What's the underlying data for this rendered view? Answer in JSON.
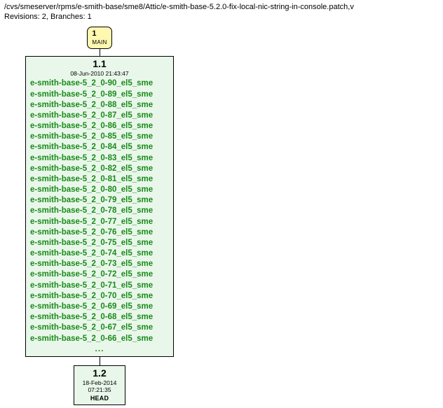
{
  "header": {
    "path": "/cvs/smeserver/rpms/e-smith-base/sme8/Attic/e-smith-base-5.2.0-fix-local-nic-string-in-console.patch,v",
    "revisions_label": "Revisions: 2, Branches: 1"
  },
  "branch": {
    "number": "1",
    "name": "MAIN"
  },
  "rev11": {
    "title": "1.1",
    "date": "08-Jun-2010 21:43:47",
    "tags": [
      "e-smith-base-5_2_0-90_el5_sme",
      "e-smith-base-5_2_0-89_el5_sme",
      "e-smith-base-5_2_0-88_el5_sme",
      "e-smith-base-5_2_0-87_el5_sme",
      "e-smith-base-5_2_0-86_el5_sme",
      "e-smith-base-5_2_0-85_el5_sme",
      "e-smith-base-5_2_0-84_el5_sme",
      "e-smith-base-5_2_0-83_el5_sme",
      "e-smith-base-5_2_0-82_el5_sme",
      "e-smith-base-5_2_0-81_el5_sme",
      "e-smith-base-5_2_0-80_el5_sme",
      "e-smith-base-5_2_0-79_el5_sme",
      "e-smith-base-5_2_0-78_el5_sme",
      "e-smith-base-5_2_0-77_el5_sme",
      "e-smith-base-5_2_0-76_el5_sme",
      "e-smith-base-5_2_0-75_el5_sme",
      "e-smith-base-5_2_0-74_el5_sme",
      "e-smith-base-5_2_0-73_el5_sme",
      "e-smith-base-5_2_0-72_el5_sme",
      "e-smith-base-5_2_0-71_el5_sme",
      "e-smith-base-5_2_0-70_el5_sme",
      "e-smith-base-5_2_0-69_el5_sme",
      "e-smith-base-5_2_0-68_el5_sme",
      "e-smith-base-5_2_0-67_el5_sme",
      "e-smith-base-5_2_0-66_el5_sme"
    ],
    "ellipsis": "..."
  },
  "rev12": {
    "title": "1.2",
    "date": "18-Feb-2014 07:21:35",
    "head": "HEAD"
  },
  "chart_data": {
    "type": "table",
    "title": "CVS revision graph",
    "nodes": [
      {
        "id": "branch",
        "label": "1 MAIN",
        "kind": "branch"
      },
      {
        "id": "1.1",
        "label": "1.1",
        "date": "08-Jun-2010 21:43:47",
        "tag_count_shown": 25,
        "truncated": true
      },
      {
        "id": "1.2",
        "label": "1.2",
        "date": "18-Feb-2014 07:21:35",
        "is_head": true
      }
    ],
    "edges": [
      {
        "from": "branch",
        "to": "1.1"
      },
      {
        "from": "1.1",
        "to": "1.2"
      }
    ]
  }
}
